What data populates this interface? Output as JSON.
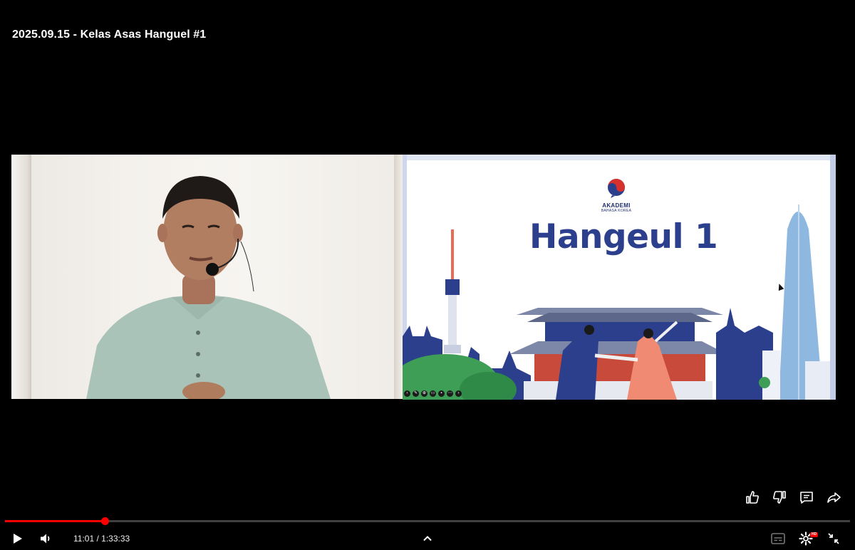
{
  "video": {
    "title": "2025.09.15 - Kelas Asas Hanguel #1",
    "time_current": "11:01",
    "time_separator": " / ",
    "time_total": "1:33:33",
    "progress_fraction": 0.1178
  },
  "slide": {
    "logo_name": "AKADEMI",
    "logo_sub": "BAHASA KOREA",
    "headline": "Hangeul 1"
  },
  "icons": {
    "like": "thumbs-up-icon",
    "dislike": "thumbs-down-icon",
    "comments": "comment-icon",
    "share": "share-icon",
    "play": "play-icon",
    "volume": "volume-icon",
    "chevron": "chevron-up-icon",
    "subtitles": "subtitles-icon",
    "settings": "settings-icon",
    "exit_fullscreen": "exit-fullscreen-icon"
  },
  "badge": {
    "hd": "HD"
  },
  "colors": {
    "accent": "#ff0000",
    "slide_title": "#2b3f8c"
  }
}
